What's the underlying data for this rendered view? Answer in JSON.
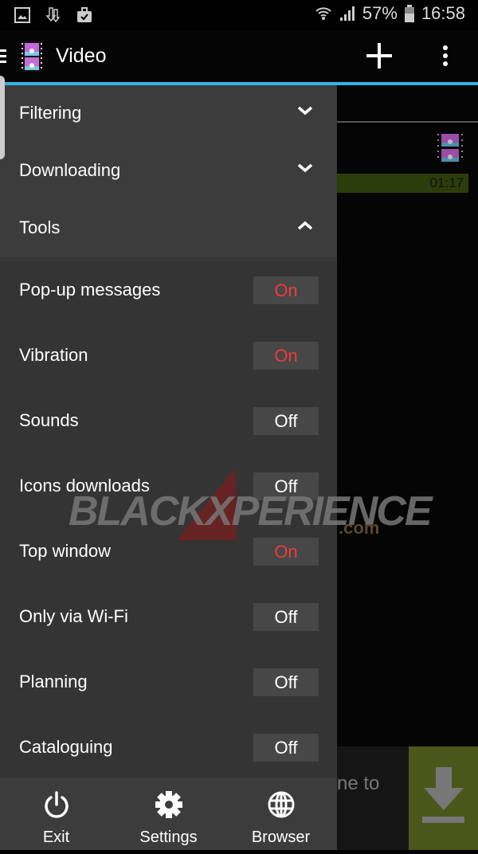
{
  "status_bar": {
    "battery": "57%",
    "time": "16:58",
    "left_icons": [
      "gallery-icon",
      "download-icon",
      "briefcase-check-icon"
    ],
    "right_icons": [
      "wifi-icon",
      "signal-icon",
      "battery-icon"
    ]
  },
  "app_bar": {
    "title": "Video",
    "actions": [
      "add-icon",
      "more-vert-icon"
    ]
  },
  "background": {
    "progress_time": "01:17",
    "banner_text": "ne to"
  },
  "drawer": {
    "sections": [
      {
        "label": "Filtering",
        "expanded": false
      },
      {
        "label": "Downloading",
        "expanded": false
      },
      {
        "label": "Tools",
        "expanded": true
      }
    ],
    "tools": [
      {
        "label": "Pop-up messages",
        "state": "On"
      },
      {
        "label": "Vibration",
        "state": "On"
      },
      {
        "label": "Sounds",
        "state": "Off"
      },
      {
        "label": "Icons downloads",
        "state": "Off"
      },
      {
        "label": "Top window",
        "state": "On"
      },
      {
        "label": "Only via Wi-Fi",
        "state": "Off"
      },
      {
        "label": "Planning",
        "state": "Off"
      },
      {
        "label": "Cataloguing",
        "state": "Off"
      }
    ],
    "bottom_buttons": [
      {
        "label": "Exit",
        "icon": "power-icon"
      },
      {
        "label": "Settings",
        "icon": "gear-icon"
      },
      {
        "label": "Browser",
        "icon": "globe-icon"
      }
    ]
  },
  "watermark": {
    "text": "BLACKXPERIENCE",
    "suffix": ".com"
  },
  "colors": {
    "accent": "#33b5e5",
    "on": "#ee3b3b",
    "off": "#ffffff",
    "drawer_bg": "#343434",
    "section_bg": "#3c3c3c"
  }
}
